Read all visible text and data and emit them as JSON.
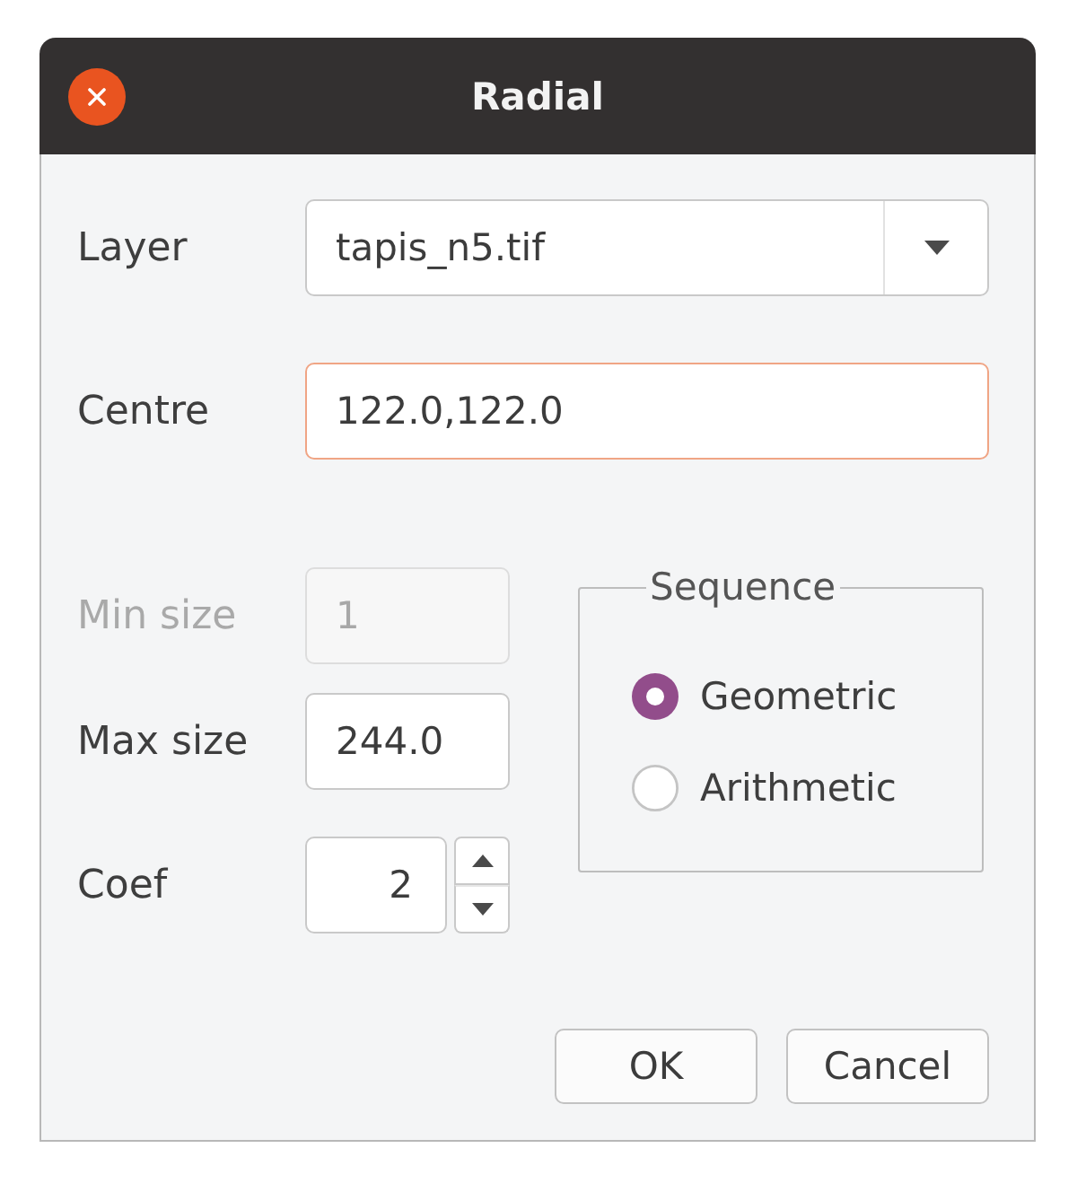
{
  "window": {
    "title": "Radial"
  },
  "fields": [
    {
      "kind": "combo",
      "label": "Layer",
      "value": "tapis_n5.tif",
      "focused": false
    },
    {
      "kind": "text",
      "label": "Centre",
      "value": "122.0,122.0",
      "focused": true
    }
  ],
  "size_fields": [
    {
      "kind": "text",
      "label": "Min size",
      "value": "1",
      "disabled": true
    },
    {
      "kind": "text",
      "label": "Max size",
      "value": "244.0",
      "disabled": false
    },
    {
      "kind": "spin",
      "label": "Coef",
      "value": "2",
      "disabled": false
    }
  ],
  "sequence": {
    "title": "Sequence",
    "options": [
      {
        "label": "Geometric",
        "selected": true
      },
      {
        "label": "Arithmetic",
        "selected": false
      }
    ]
  },
  "buttons": [
    {
      "label": "OK"
    },
    {
      "label": "Cancel"
    }
  ]
}
